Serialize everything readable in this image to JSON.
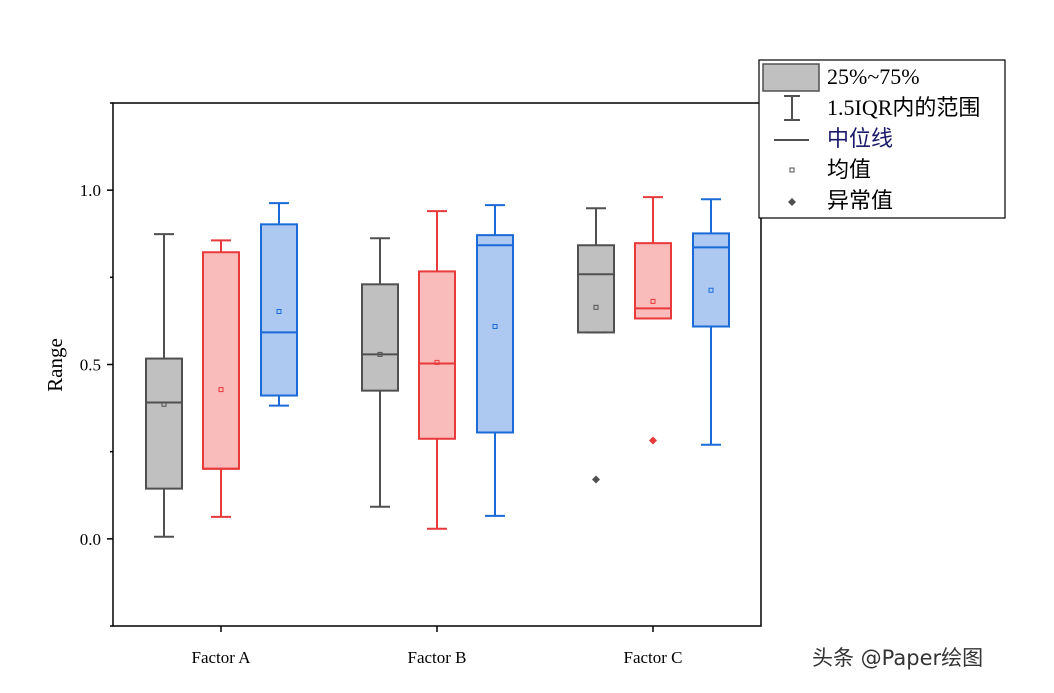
{
  "chart_data": {
    "type": "box",
    "title": "",
    "xlabel": "",
    "ylabel": "Range",
    "ylim": [
      -0.25,
      1.25
    ],
    "yticks": [
      0.0,
      0.5,
      1.0
    ],
    "ytick_labels": [
      "0.0",
      "0.5",
      "1.0"
    ],
    "grid": false,
    "categories": [
      "Factor A",
      "Factor B",
      "Factor C"
    ],
    "series": [
      {
        "color": "#505050",
        "fill": "#c0c0c0",
        "boxes": [
          {
            "min": 0.006,
            "q1": 0.144,
            "median": 0.391,
            "q3": 0.517,
            "max": 0.874,
            "mean": 0.386,
            "outliers": []
          },
          {
            "min": 0.092,
            "q1": 0.425,
            "median": 0.529,
            "q3": 0.73,
            "max": 0.862,
            "mean": 0.529,
            "outliers": []
          },
          {
            "min": 0.592,
            "q1": 0.592,
            "median": 0.759,
            "q3": 0.842,
            "max": 0.948,
            "mean": 0.664,
            "outliers": [
              0.17
            ]
          }
        ]
      },
      {
        "color": "#e8393b",
        "fill": "#fabbbb",
        "boxes": [
          {
            "min": 0.063,
            "q1": 0.201,
            "median": 0.201,
            "q3": 0.822,
            "max": 0.856,
            "mean": 0.428,
            "outliers": []
          },
          {
            "min": 0.029,
            "q1": 0.287,
            "median": 0.503,
            "q3": 0.767,
            "max": 0.94,
            "mean": 0.506,
            "outliers": []
          },
          {
            "min": 0.632,
            "q1": 0.632,
            "median": 0.661,
            "q3": 0.848,
            "max": 0.98,
            "mean": 0.681,
            "outliers": [
              0.282
            ]
          }
        ]
      },
      {
        "color": "#1a6ad8",
        "fill": "#adc9f2",
        "boxes": [
          {
            "min": 0.382,
            "q1": 0.411,
            "median": 0.592,
            "q3": 0.902,
            "max": 0.963,
            "mean": 0.652,
            "outliers": []
          },
          {
            "min": 0.066,
            "q1": 0.305,
            "median": 0.842,
            "q3": 0.871,
            "max": 0.957,
            "mean": 0.609,
            "outliers": []
          },
          {
            "min": 0.27,
            "q1": 0.609,
            "median": 0.836,
            "q3": 0.876,
            "max": 0.974,
            "mean": 0.713,
            "outliers": []
          }
        ]
      }
    ],
    "legend": {
      "position": "top-right",
      "entries": [
        "25%~75%",
        "1.5IQR内的范围",
        "中位线",
        "均值",
        "异常值"
      ]
    }
  },
  "watermark": "头条 @Paper绘图"
}
